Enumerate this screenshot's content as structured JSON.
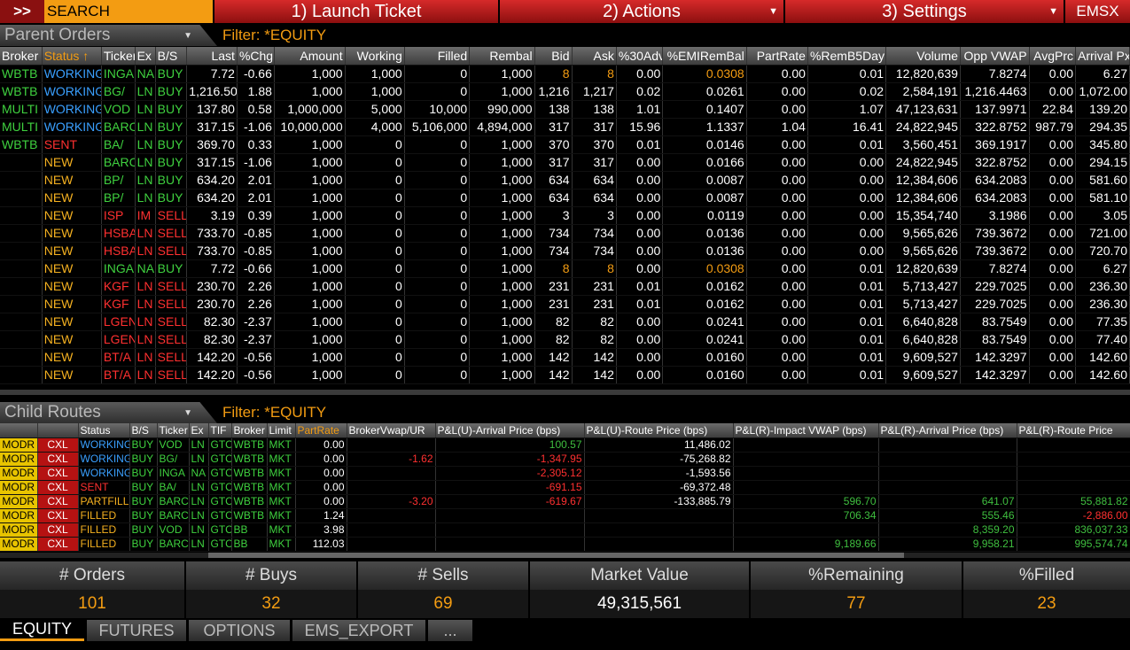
{
  "topbar": {
    "arrows": ">>",
    "search": "SEARCH",
    "launch": "1)  Launch Ticket",
    "actions": "2)  Actions",
    "settings": "3)  Settings",
    "emsx": "EMSX"
  },
  "parent": {
    "title": "Parent Orders",
    "filter": "Filter: *EQUITY",
    "columns": [
      "Broker",
      "Status",
      "Ticker",
      "Ex",
      "B/S",
      "Last",
      "%Chg",
      "Amount",
      "Working",
      "Filled",
      "Rembal",
      "Bid",
      "Ask",
      "%30Adv",
      "%EMIRemBal",
      "PartRate",
      "%RemB5Day",
      "Volume",
      "Opp VWAP",
      "AvgPrc",
      "Arrival Px"
    ],
    "status_sort": "↑",
    "rows": [
      [
        "WBTB",
        "WORKING",
        "INGA",
        "NA",
        "BUY",
        "7.72",
        "-0.66",
        "1,000",
        "1,000",
        "0",
        "1,000",
        "8",
        "8",
        "0.00",
        "0.0308",
        "0.00",
        "0.01",
        "12,820,639",
        "7.8274",
        "0.00",
        "6.27"
      ],
      [
        "WBTB",
        "WORKING",
        "BG/",
        "LN",
        "BUY",
        "1,216.50",
        "1.88",
        "1,000",
        "1,000",
        "0",
        "1,000",
        "1,216",
        "1,217",
        "0.02",
        "0.0261",
        "0.00",
        "0.02",
        "2,584,191",
        "1,216.4463",
        "0.00",
        "1,072.00"
      ],
      [
        "MULTI",
        "WORKING",
        "VOD",
        "LN",
        "BUY",
        "137.80",
        "0.58",
        "1,000,000",
        "5,000",
        "10,000",
        "990,000",
        "138",
        "138",
        "1.01",
        "0.1407",
        "0.00",
        "1.07",
        "47,123,631",
        "137.9971",
        "22.84",
        "139.20"
      ],
      [
        "MULTI",
        "WORKING",
        "BARC",
        "LN",
        "BUY",
        "317.15",
        "-1.06",
        "10,000,000",
        "4,000",
        "5,106,000",
        "4,894,000",
        "317",
        "317",
        "15.96",
        "1.1337",
        "1.04",
        "16.41",
        "24,822,945",
        "322.8752",
        "987.79",
        "294.35"
      ],
      [
        "WBTB",
        "SENT",
        "BA/",
        "LN",
        "BUY",
        "369.70",
        "0.33",
        "1,000",
        "0",
        "0",
        "1,000",
        "370",
        "370",
        "0.01",
        "0.0146",
        "0.00",
        "0.01",
        "3,560,451",
        "369.1917",
        "0.00",
        "345.80"
      ],
      [
        "",
        "NEW",
        "BARC",
        "LN",
        "BUY",
        "317.15",
        "-1.06",
        "1,000",
        "0",
        "0",
        "1,000",
        "317",
        "317",
        "0.00",
        "0.0166",
        "0.00",
        "0.00",
        "24,822,945",
        "322.8752",
        "0.00",
        "294.15"
      ],
      [
        "",
        "NEW",
        "BP/",
        "LN",
        "BUY",
        "634.20",
        "2.01",
        "1,000",
        "0",
        "0",
        "1,000",
        "634",
        "634",
        "0.00",
        "0.0087",
        "0.00",
        "0.00",
        "12,384,606",
        "634.2083",
        "0.00",
        "581.60"
      ],
      [
        "",
        "NEW",
        "BP/",
        "LN",
        "BUY",
        "634.20",
        "2.01",
        "1,000",
        "0",
        "0",
        "1,000",
        "634",
        "634",
        "0.00",
        "0.0087",
        "0.00",
        "0.00",
        "12,384,606",
        "634.2083",
        "0.00",
        "581.10"
      ],
      [
        "",
        "NEW",
        "ISP",
        "IM",
        "SELL",
        "3.19",
        "0.39",
        "1,000",
        "0",
        "0",
        "1,000",
        "3",
        "3",
        "0.00",
        "0.0119",
        "0.00",
        "0.00",
        "15,354,740",
        "3.1986",
        "0.00",
        "3.05"
      ],
      [
        "",
        "NEW",
        "HSBA",
        "LN",
        "SELL",
        "733.70",
        "-0.85",
        "1,000",
        "0",
        "0",
        "1,000",
        "734",
        "734",
        "0.00",
        "0.0136",
        "0.00",
        "0.00",
        "9,565,626",
        "739.3672",
        "0.00",
        "721.00"
      ],
      [
        "",
        "NEW",
        "HSBA",
        "LN",
        "SELL",
        "733.70",
        "-0.85",
        "1,000",
        "0",
        "0",
        "1,000",
        "734",
        "734",
        "0.00",
        "0.0136",
        "0.00",
        "0.00",
        "9,565,626",
        "739.3672",
        "0.00",
        "720.70"
      ],
      [
        "",
        "NEW",
        "INGA",
        "NA",
        "BUY",
        "7.72",
        "-0.66",
        "1,000",
        "0",
        "0",
        "1,000",
        "8",
        "8",
        "0.00",
        "0.0308",
        "0.00",
        "0.01",
        "12,820,639",
        "7.8274",
        "0.00",
        "6.27"
      ],
      [
        "",
        "NEW",
        "KGF",
        "LN",
        "SELL",
        "230.70",
        "2.26",
        "1,000",
        "0",
        "0",
        "1,000",
        "231",
        "231",
        "0.01",
        "0.0162",
        "0.00",
        "0.01",
        "5,713,427",
        "229.7025",
        "0.00",
        "236.30"
      ],
      [
        "",
        "NEW",
        "KGF",
        "LN",
        "SELL",
        "230.70",
        "2.26",
        "1,000",
        "0",
        "0",
        "1,000",
        "231",
        "231",
        "0.01",
        "0.0162",
        "0.00",
        "0.01",
        "5,713,427",
        "229.7025",
        "0.00",
        "236.30"
      ],
      [
        "",
        "NEW",
        "LGEN",
        "LN",
        "SELL",
        "82.30",
        "-2.37",
        "1,000",
        "0",
        "0",
        "1,000",
        "82",
        "82",
        "0.00",
        "0.0241",
        "0.00",
        "0.01",
        "6,640,828",
        "83.7549",
        "0.00",
        "77.35"
      ],
      [
        "",
        "NEW",
        "LGEN",
        "LN",
        "SELL",
        "82.30",
        "-2.37",
        "1,000",
        "0",
        "0",
        "1,000",
        "82",
        "82",
        "0.00",
        "0.0241",
        "0.00",
        "0.01",
        "6,640,828",
        "83.7549",
        "0.00",
        "77.40"
      ],
      [
        "",
        "NEW",
        "BT/A",
        "LN",
        "SELL",
        "142.20",
        "-0.56",
        "1,000",
        "0",
        "0",
        "1,000",
        "142",
        "142",
        "0.00",
        "0.0160",
        "0.00",
        "0.01",
        "9,609,527",
        "142.3297",
        "0.00",
        "142.60"
      ],
      [
        "",
        "NEW",
        "BT/A",
        "LN",
        "SELL",
        "142.20",
        "-0.56",
        "1,000",
        "0",
        "0",
        "1,000",
        "142",
        "142",
        "0.00",
        "0.0160",
        "0.00",
        "0.01",
        "9,609,527",
        "142.3297",
        "0.00",
        "142.60"
      ]
    ]
  },
  "child": {
    "title": "Child Routes",
    "filter": "Filter: *EQUITY",
    "columns": [
      "",
      "",
      "Status",
      "B/S",
      "Ticker",
      "Ex",
      "TIF",
      "Broker",
      "Limit",
      "PartRate",
      "BrokerVwap/UR",
      "P&L(U)-Arrival Price (bps)",
      "P&L(U)-Route Price (bps)",
      "P&L(R)-Impact VWAP (bps)",
      "P&L(R)-Arrival Price (bps)",
      "P&L(R)-Route Price"
    ],
    "rows": [
      [
        "MODR",
        "CXL",
        "WORKING",
        "BUY",
        "VOD",
        "LN",
        "GTC",
        "WBTB",
        "MKT",
        "0.00",
        "",
        "100.57",
        "11,486.02",
        "",
        "",
        ""
      ],
      [
        "MODR",
        "CXL",
        "WORKING",
        "BUY",
        "BG/",
        "LN",
        "GTC",
        "WBTB",
        "MKT",
        "0.00",
        "-1.62",
        "-1,347.95",
        "-75,268.82",
        "",
        "",
        ""
      ],
      [
        "MODR",
        "CXL",
        "WORKING",
        "BUY",
        "INGA",
        "NA",
        "GTC",
        "WBTB",
        "MKT",
        "0.00",
        "",
        "-2,305.12",
        "-1,593.56",
        "",
        "",
        ""
      ],
      [
        "MODR",
        "CXL",
        "SENT",
        "BUY",
        "BA/",
        "LN",
        "GTC",
        "WBTB",
        "MKT",
        "0.00",
        "",
        "-691.15",
        "-69,372.48",
        "",
        "",
        ""
      ],
      [
        "MODR",
        "CXL",
        "PARTFILL",
        "BUY",
        "BARC",
        "LN",
        "GTC",
        "WBTB",
        "MKT",
        "0.00",
        "-3.20",
        "-619.67",
        "-133,885.79",
        "596.70",
        "641.07",
        "55,881.82"
      ],
      [
        "MODR",
        "CXL",
        "FILLED",
        "BUY",
        "BARC",
        "LN",
        "GTC",
        "WBTB",
        "MKT",
        "1.24",
        "",
        "",
        "",
        "706.34",
        "555.46",
        "-2,886.00"
      ],
      [
        "MODR",
        "CXL",
        "FILLED",
        "BUY",
        "VOD",
        "LN",
        "GTC",
        "BB",
        "MKT",
        "3.98",
        "",
        "",
        "",
        "",
        "8,359.20",
        "836,037.33"
      ],
      [
        "MODR",
        "CXL",
        "FILLED",
        "BUY",
        "BARC",
        "LN",
        "GTC",
        "BB",
        "MKT",
        "112.03",
        "",
        "",
        "",
        "9,189.66",
        "9,958.21",
        "995,574.74"
      ]
    ]
  },
  "stats": [
    {
      "label": "# Orders",
      "value": "101"
    },
    {
      "label": "# Buys",
      "value": "32"
    },
    {
      "label": "# Sells",
      "value": "69"
    },
    {
      "label": "Market Value",
      "value": "49,315,561"
    },
    {
      "label": "%Remaining",
      "value": "77"
    },
    {
      "label": "%Filled",
      "value": "23"
    }
  ],
  "tabs": [
    "EQUITY",
    "FUTURES",
    "OPTIONS",
    "EMS_EXPORT",
    "..."
  ],
  "colors": {
    "accent": "#f39c12",
    "working": "#3aa0ff",
    "sent": "#ff3030",
    "new": "#f5b120",
    "positive": "#3fd13f",
    "negative": "#ff3030"
  }
}
